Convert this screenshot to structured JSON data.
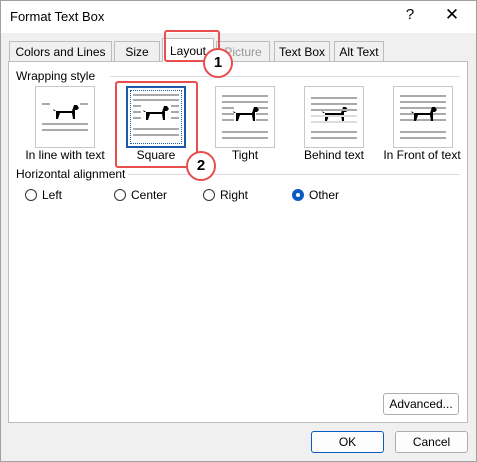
{
  "window": {
    "title": "Format Text Box",
    "help_glyph": "?",
    "close_glyph": "✕"
  },
  "tabs": [
    {
      "label": "Colors and Lines"
    },
    {
      "label": "Size"
    },
    {
      "label": "Layout",
      "active": true
    },
    {
      "label": "Picture",
      "disabled": true
    },
    {
      "label": "Text Box"
    },
    {
      "label": "Alt Text"
    }
  ],
  "wrapping": {
    "heading": "Wrapping style",
    "options": [
      {
        "label": "In line with text",
        "icon": "wrap-inline-icon"
      },
      {
        "label": "Square",
        "icon": "wrap-square-icon",
        "selected": true
      },
      {
        "label": "Tight",
        "icon": "wrap-tight-icon"
      },
      {
        "label": "Behind text",
        "icon": "wrap-behind-icon"
      },
      {
        "label": "In Front of text",
        "icon": "wrap-front-icon"
      }
    ]
  },
  "alignment": {
    "heading": "Horizontal alignment",
    "options": [
      {
        "label": "Left",
        "checked": false
      },
      {
        "label": "Center",
        "checked": false
      },
      {
        "label": "Right",
        "checked": false
      },
      {
        "label": "Other",
        "checked": true
      }
    ]
  },
  "buttons": {
    "advanced": "Advanced...",
    "ok": "OK",
    "cancel": "Cancel"
  },
  "callouts": [
    {
      "number": "1"
    },
    {
      "number": "2"
    }
  ],
  "colors": {
    "accent": "#0a5cc4",
    "callout": "#e84e4e"
  }
}
